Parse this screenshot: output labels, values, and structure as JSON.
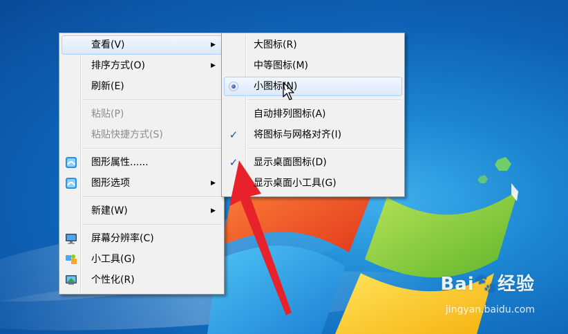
{
  "main_menu": {
    "items": [
      {
        "label": "查看(V)",
        "submenu": true,
        "highlighted": true
      },
      {
        "label": "排序方式(O)",
        "submenu": true
      },
      {
        "label": "刷新(E)"
      },
      {
        "label": "粘贴(P)",
        "disabled": true
      },
      {
        "label": "粘贴快捷方式(S)",
        "disabled": true
      },
      {
        "label": "图形属性......",
        "icon": "graphics-icon"
      },
      {
        "label": "图形选项",
        "icon": "graphics-icon",
        "submenu": true
      },
      {
        "label": "新建(W)",
        "submenu": true
      },
      {
        "label": "屏幕分辨率(C)",
        "icon": "monitor-icon"
      },
      {
        "label": "小工具(G)",
        "icon": "gadgets-icon"
      },
      {
        "label": "个性化(R)",
        "icon": "personalize-icon"
      }
    ]
  },
  "view_submenu": {
    "items": [
      {
        "label": "大图标(R)"
      },
      {
        "label": "中等图标(M)"
      },
      {
        "label": "小图标(N)",
        "selected": true,
        "highlighted": true
      },
      {
        "label": "自动排列图标(A)"
      },
      {
        "label": "将图标与网格对齐(I)",
        "checked": true
      },
      {
        "label": "显示桌面图标(D)",
        "checked": true
      },
      {
        "label": "显示桌面小工具(G)"
      }
    ]
  },
  "watermark": {
    "brand": "Bai",
    "brand2": "经验",
    "url": "jingyan.baidu.com"
  },
  "colors": {
    "highlight": "#dbe9fb",
    "check": "#1e4fb4",
    "annotation_arrow": "#e8222a"
  }
}
